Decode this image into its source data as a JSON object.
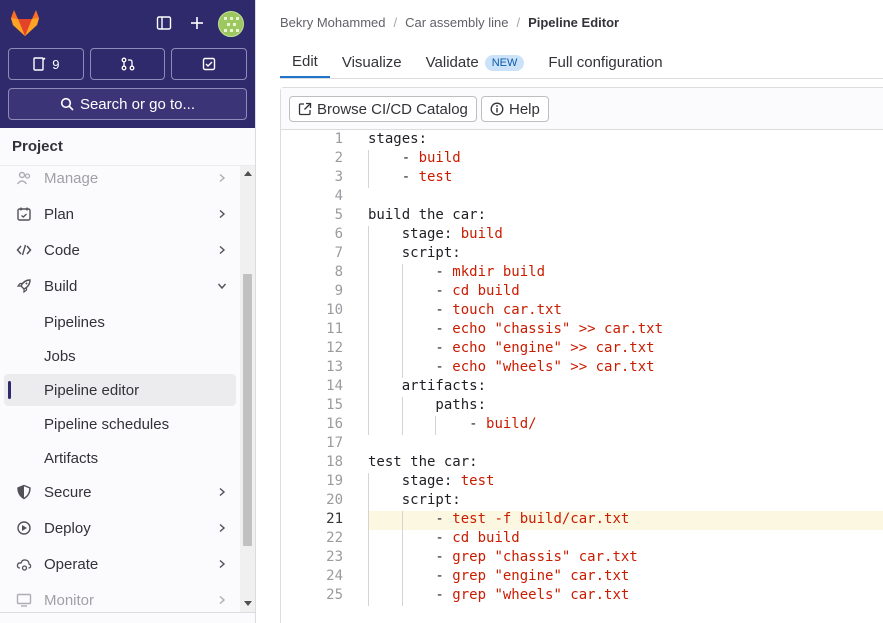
{
  "sidebar": {
    "counters": {
      "issues": "9"
    },
    "search_label": "Search or go to...",
    "section_title": "Project",
    "nav": [
      {
        "label": "Manage",
        "icon": "users-icon"
      },
      {
        "label": "Plan",
        "icon": "calendar-icon"
      },
      {
        "label": "Code",
        "icon": "code-icon"
      },
      {
        "label": "Build",
        "icon": "rocket-icon"
      },
      {
        "label": "Secure",
        "icon": "shield-icon"
      },
      {
        "label": "Deploy",
        "icon": "deploy-icon"
      },
      {
        "label": "Operate",
        "icon": "cloud-gear-icon"
      },
      {
        "label": "Monitor",
        "icon": "monitor-icon"
      }
    ],
    "build_items": [
      {
        "label": "Pipelines"
      },
      {
        "label": "Jobs"
      },
      {
        "label": "Pipeline editor"
      },
      {
        "label": "Pipeline schedules"
      },
      {
        "label": "Artifacts"
      }
    ]
  },
  "breadcrumb": {
    "items": [
      "Bekry Mohammed",
      "Car assembly line",
      "Pipeline Editor"
    ]
  },
  "tabs": {
    "edit": "Edit",
    "visualize": "Visualize",
    "validate": "Validate",
    "validate_badge": "NEW",
    "full_config": "Full configuration"
  },
  "toolbar": {
    "catalog": "Browse CI/CD Catalog",
    "help": "Help"
  },
  "editor": {
    "current_line": 21,
    "lines": [
      [
        [
          "k",
          "stages:"
        ]
      ],
      [
        [
          "k",
          "    - "
        ],
        [
          "s",
          "build"
        ]
      ],
      [
        [
          "k",
          "    - "
        ],
        [
          "s",
          "test"
        ]
      ],
      [
        [
          "k",
          ""
        ]
      ],
      [
        [
          "k",
          "build the car:"
        ]
      ],
      [
        [
          "k",
          "    stage: "
        ],
        [
          "s",
          "build"
        ]
      ],
      [
        [
          "k",
          "    script:"
        ]
      ],
      [
        [
          "k",
          "        - "
        ],
        [
          "s",
          "mkdir build"
        ]
      ],
      [
        [
          "k",
          "        - "
        ],
        [
          "s",
          "cd build"
        ]
      ],
      [
        [
          "k",
          "        - "
        ],
        [
          "s",
          "touch car.txt"
        ]
      ],
      [
        [
          "k",
          "        - "
        ],
        [
          "s",
          "echo \"chassis\" >> car.txt"
        ]
      ],
      [
        [
          "k",
          "        - "
        ],
        [
          "s",
          "echo \"engine\" >> car.txt"
        ]
      ],
      [
        [
          "k",
          "        - "
        ],
        [
          "s",
          "echo \"wheels\" >> car.txt"
        ]
      ],
      [
        [
          "k",
          "    artifacts:"
        ]
      ],
      [
        [
          "k",
          "        paths:"
        ]
      ],
      [
        [
          "k",
          "            - "
        ],
        [
          "s",
          "build/"
        ]
      ],
      [
        [
          "k",
          ""
        ]
      ],
      [
        [
          "k",
          "test the car:"
        ]
      ],
      [
        [
          "k",
          "    stage: "
        ],
        [
          "s",
          "test"
        ]
      ],
      [
        [
          "k",
          "    script:"
        ]
      ],
      [
        [
          "k",
          "        - "
        ],
        [
          "s",
          "test -f build/car.txt"
        ]
      ],
      [
        [
          "k",
          "        - "
        ],
        [
          "s",
          "cd build"
        ]
      ],
      [
        [
          "k",
          "        - "
        ],
        [
          "s",
          "grep \"chassis\" car.txt"
        ]
      ],
      [
        [
          "k",
          "        - "
        ],
        [
          "s",
          "grep \"engine\" car.txt"
        ]
      ],
      [
        [
          "k",
          "        - "
        ],
        [
          "s",
          "grep \"wheels\" car.txt"
        ]
      ]
    ]
  },
  "colors": {
    "sidebar_top": "#2f2a6b",
    "accent": "#1f75cb",
    "string": "#c91c00"
  }
}
